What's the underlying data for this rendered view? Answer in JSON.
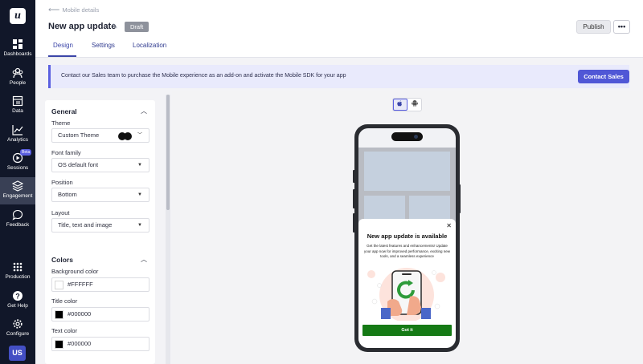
{
  "app": {
    "logo_letter": "u",
    "nav": [
      {
        "label": "Dashboards",
        "icon": "dashboards-icon"
      },
      {
        "label": "People",
        "icon": "people-icon"
      },
      {
        "label": "Data",
        "icon": "data-icon"
      },
      {
        "label": "Analytics",
        "icon": "analytics-icon"
      },
      {
        "label": "Sessions",
        "icon": "sessions-icon",
        "badge": "Beta"
      },
      {
        "label": "Engagement",
        "icon": "engagement-icon",
        "active": true
      },
      {
        "label": "Feedback",
        "icon": "feedback-icon"
      },
      {
        "label": "Production",
        "icon": "production-icon"
      },
      {
        "label": "Get Help",
        "icon": "help-icon"
      },
      {
        "label": "Configure",
        "icon": "configure-icon"
      }
    ],
    "avatar_initials": "US"
  },
  "header": {
    "back_label": "Mobile details",
    "title": "New app update",
    "status_badge": "Draft",
    "publish_label": "Publish",
    "more_label": "•••",
    "tabs": [
      {
        "label": "Design",
        "active": true
      },
      {
        "label": "Settings"
      },
      {
        "label": "Localization"
      }
    ]
  },
  "banner": {
    "text": "Contact our Sales team to purchase the Mobile experience as an add-on and activate the Mobile SDK for your app",
    "button_label": "Contact Sales"
  },
  "general": {
    "title": "General",
    "theme_label": "Theme",
    "theme_value": "Custom Theme",
    "font_label": "Font family",
    "font_value": "OS default font",
    "position_label": "Position",
    "position_value": "Bottom",
    "layout_label": "Layout",
    "layout_value": "Title, text and image"
  },
  "colors": {
    "title": "Colors",
    "background_label": "Background color",
    "background_value": "#FFFFFF",
    "title_color_label": "Title color",
    "title_color_value": "#000000",
    "text_color_label": "Text color",
    "text_color_value": "#000000"
  },
  "preview": {
    "os_selected": "iOS",
    "modal_title": "New app update is available",
    "modal_body": "Get the latest features and enhancements! Update your app now for improved performance, exciting new tools, and a seamless experience",
    "cta_label": "Got it",
    "cta_color": "#157a15"
  }
}
